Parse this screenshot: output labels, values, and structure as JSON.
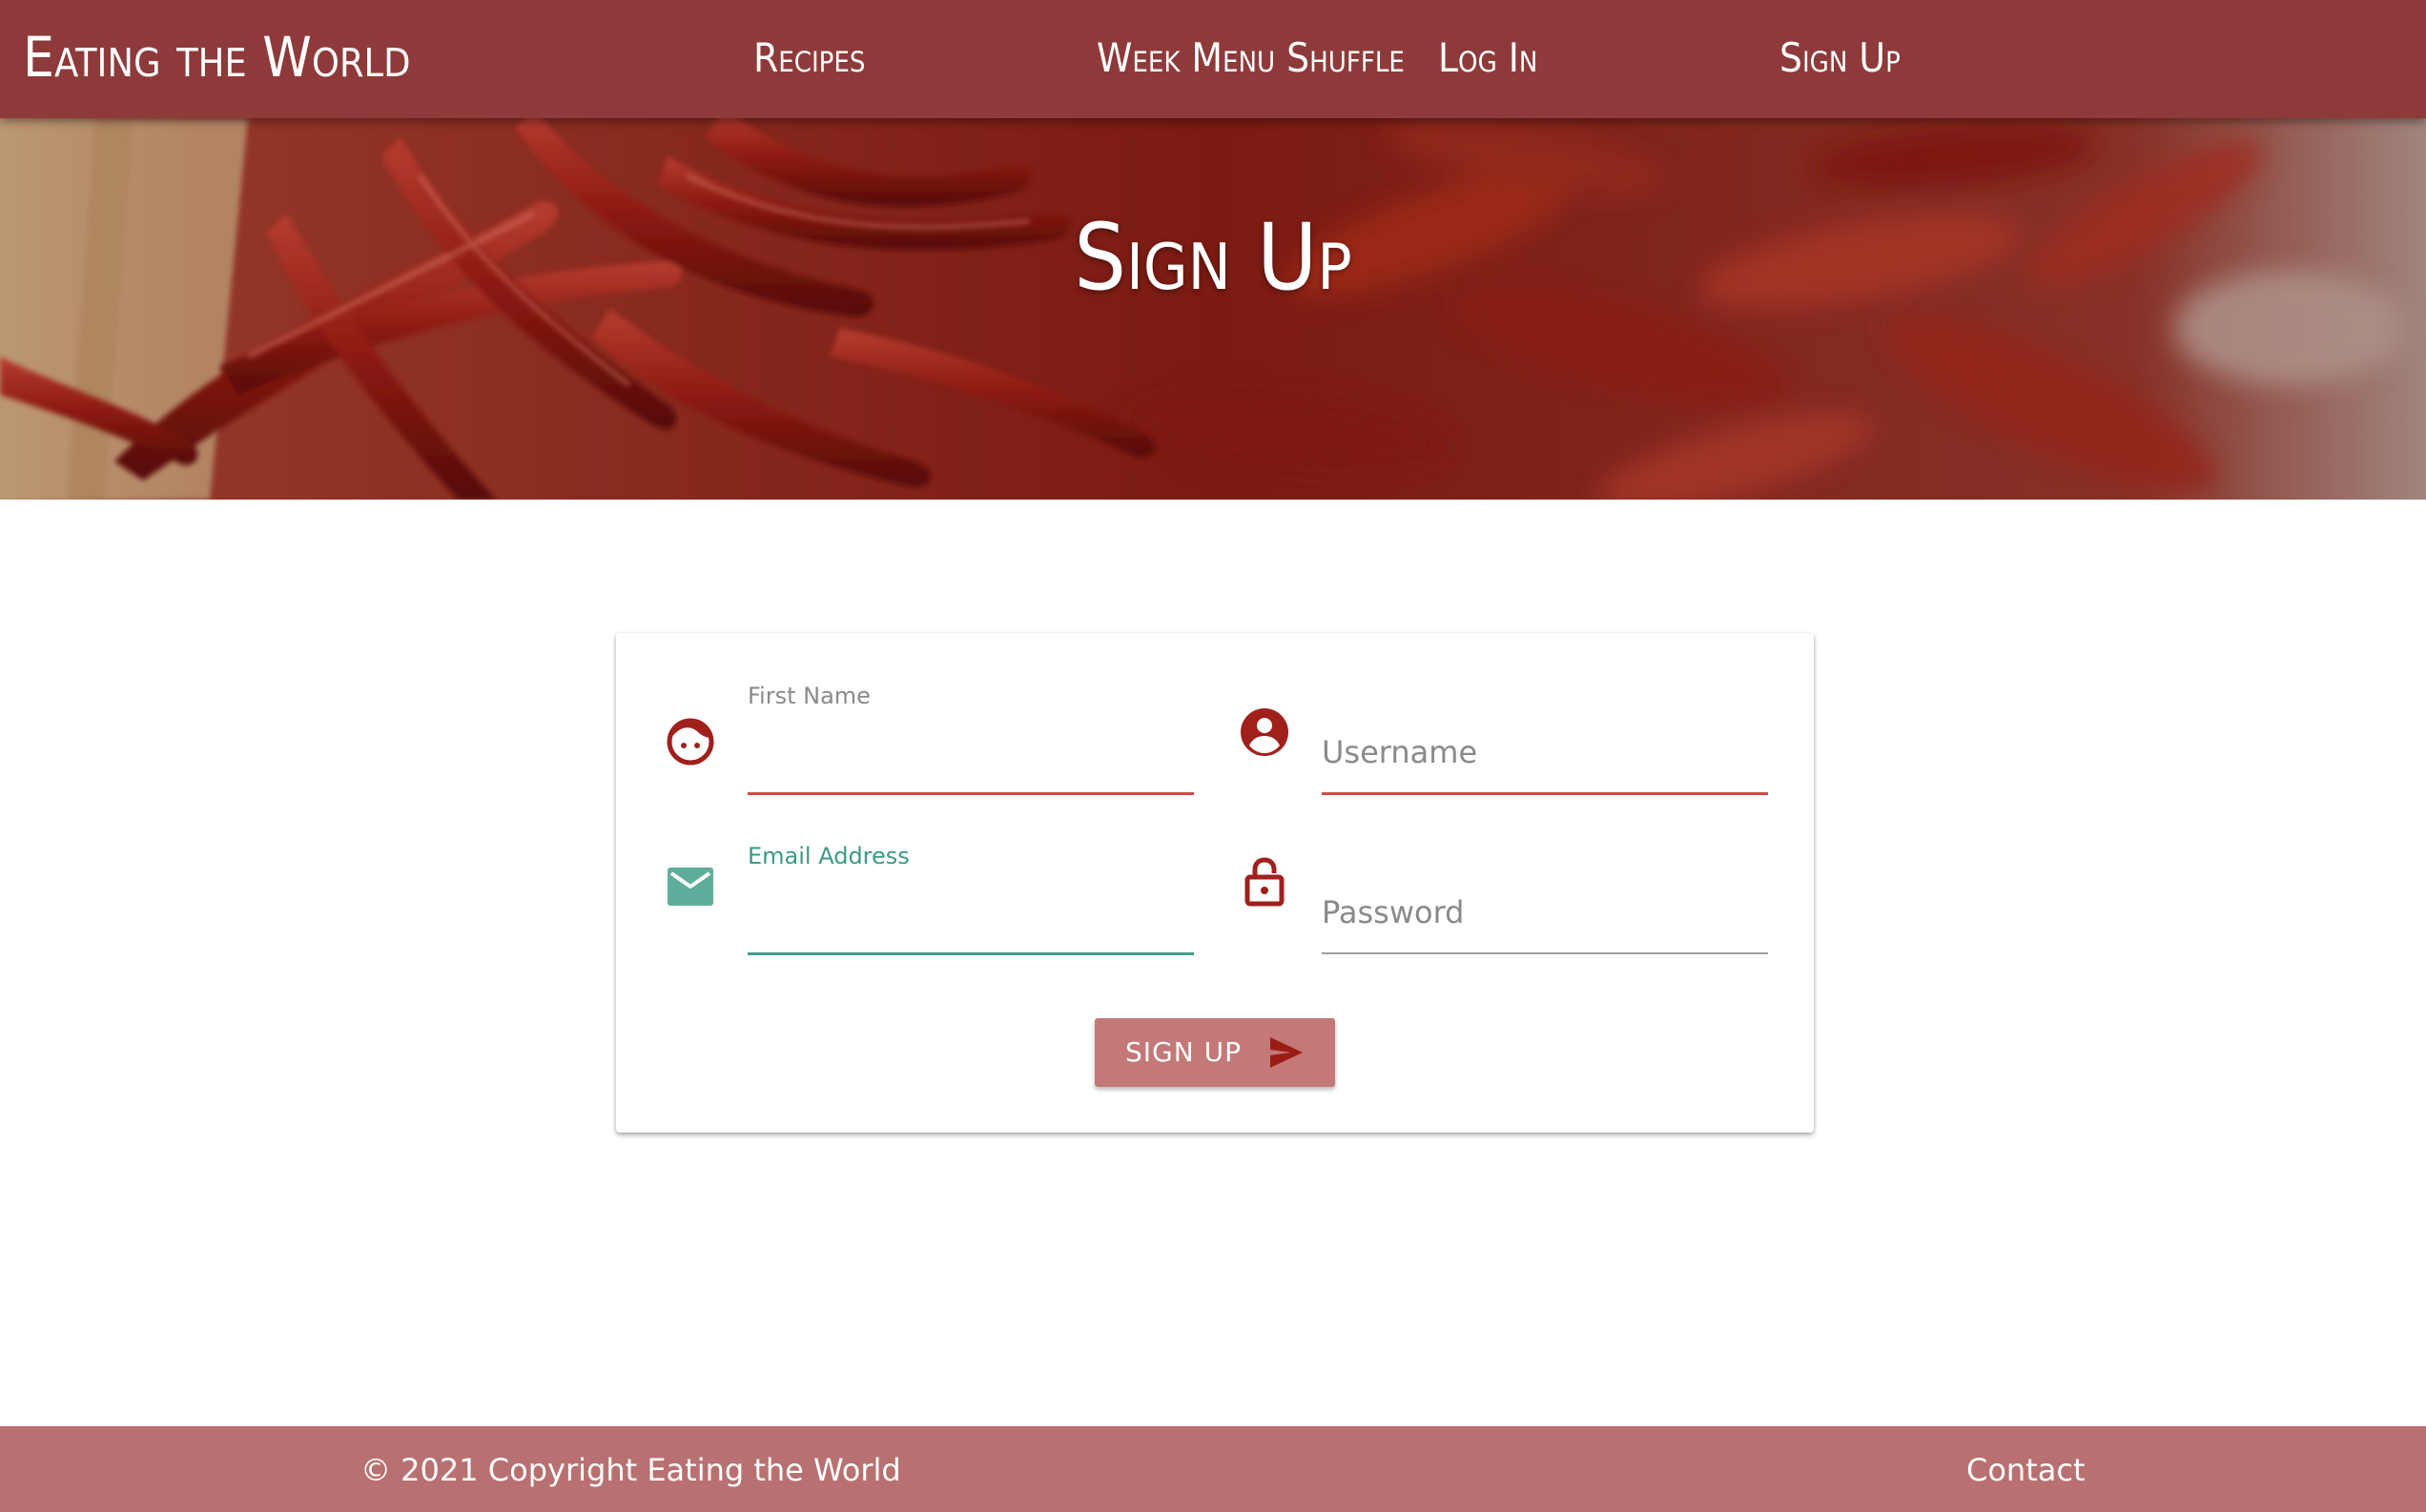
{
  "navbar": {
    "brand": "Eating the World",
    "links": [
      "Recipes",
      "Week Menu Shuffle",
      "Log In",
      "Sign Up"
    ]
  },
  "hero": {
    "title": "Sign Up",
    "image_icon": "red-chili-peppers-photo"
  },
  "form": {
    "fields": {
      "first_name": {
        "label": "First Name",
        "value": "",
        "icon": "face-icon",
        "state": "floating-label-error"
      },
      "username": {
        "placeholder": "Username",
        "value": "",
        "icon": "account-circle-icon",
        "state": "error"
      },
      "email": {
        "label": "Email Address",
        "value": "",
        "icon": "email-icon",
        "state": "focused"
      },
      "password": {
        "placeholder": "Password",
        "value": "",
        "icon": "lock-open-icon",
        "state": "default"
      }
    },
    "submit": {
      "label": "SIGN UP",
      "icon": "send-icon"
    }
  },
  "footer": {
    "copyright": "© 2021 Copyright Eating the World",
    "contact": "Contact"
  },
  "colors": {
    "primary": "#8e3a3a",
    "error": "#cf4b45",
    "focus": "#459c8a",
    "icon": "#a0201c",
    "button": "#c47878",
    "footer": "#b87070"
  }
}
